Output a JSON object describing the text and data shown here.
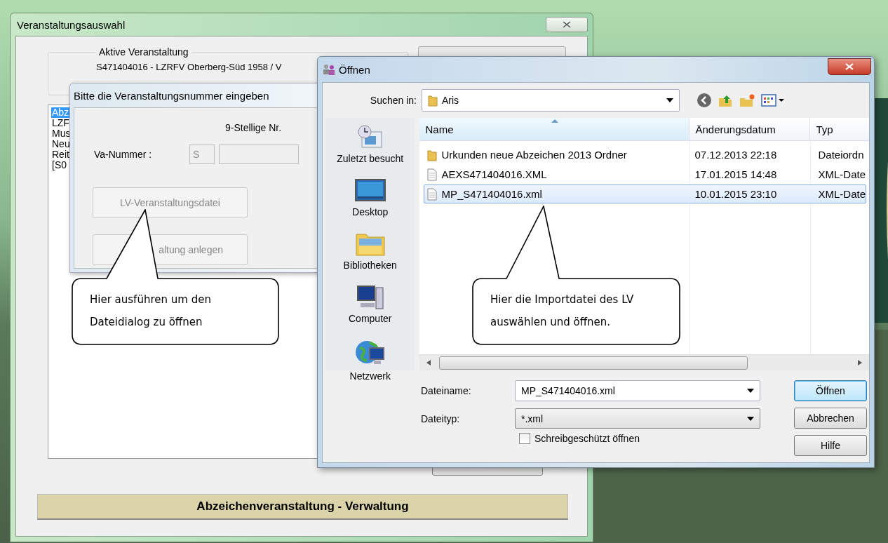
{
  "main_window": {
    "title": "Veranstaltungsauswahl",
    "active_group": {
      "label": "Aktive Veranstaltung",
      "text": "S471404016 - LZRFV Oberberg-Süd 1958 / V"
    },
    "list_items": [
      {
        "label": "Abz",
        "selected": true
      },
      {
        "label": "LZF",
        "selected": false
      },
      {
        "label": "Mus",
        "selected": false
      },
      {
        "label": "Neu",
        "selected": false
      },
      {
        "label": "Reit",
        "selected": false
      },
      {
        "label": "[S0",
        "selected": false
      }
    ],
    "footer_button": "Abzeichenveranstaltung - Verwaltung"
  },
  "number_dialog": {
    "title": "Bitte die Veranstaltungsnummer eingeben",
    "hint": "9-Stellige Nr.",
    "field_label": "Va-Nummer :",
    "prefix_value": "S",
    "buttons": [
      {
        "label": "LV-Veranstaltungsdatei",
        "disabled": true
      },
      {
        "label": "altung anlegen",
        "disabled": true
      }
    ]
  },
  "open_dialog": {
    "title": "Öffnen",
    "look_in_label": "Suchen in:",
    "look_in_value": "Aris",
    "places": [
      {
        "kind": "recent",
        "label": "Zuletzt besucht"
      },
      {
        "kind": "desktop",
        "label": "Desktop"
      },
      {
        "kind": "libraries",
        "label": "Bibliotheken"
      },
      {
        "kind": "computer",
        "label": "Computer"
      },
      {
        "kind": "network",
        "label": "Netzwerk"
      }
    ],
    "columns": [
      "Name",
      "Änderungsdatum",
      "Typ"
    ],
    "files": [
      {
        "kind": "folder",
        "name": "Urkunden neue Abzeichen 2013 Ordner",
        "date": "07.12.2013 22:18",
        "type": "Dateiordn",
        "selected": false
      },
      {
        "kind": "file",
        "name": "AEXS471404016.XML",
        "date": "17.01.2015 14:48",
        "type": "XML-Date",
        "selected": false
      },
      {
        "kind": "file",
        "name": "MP_S471404016.xml",
        "date": "10.01.2015 23:10",
        "type": "XML-Date",
        "selected": true
      }
    ],
    "filename_label": "Dateiname:",
    "filename_value": "MP_S471404016.xml",
    "filetype_label": "Dateityp:",
    "filetype_value": "*.xml",
    "readonly": {
      "label": "Schreibgeschützt öffnen",
      "checked": false
    },
    "buttons": [
      {
        "label": "Öffnen",
        "default": true
      },
      {
        "label": "Abbrechen",
        "default": false
      },
      {
        "label": "Hilfe",
        "default": false
      }
    ]
  },
  "callouts": [
    {
      "lines": [
        "Hier ausführen um den",
        "Dateidialog zu öffnen"
      ]
    },
    {
      "lines": [
        "Hier die Importdatei des LV",
        "auswählen und öffnen."
      ]
    }
  ]
}
